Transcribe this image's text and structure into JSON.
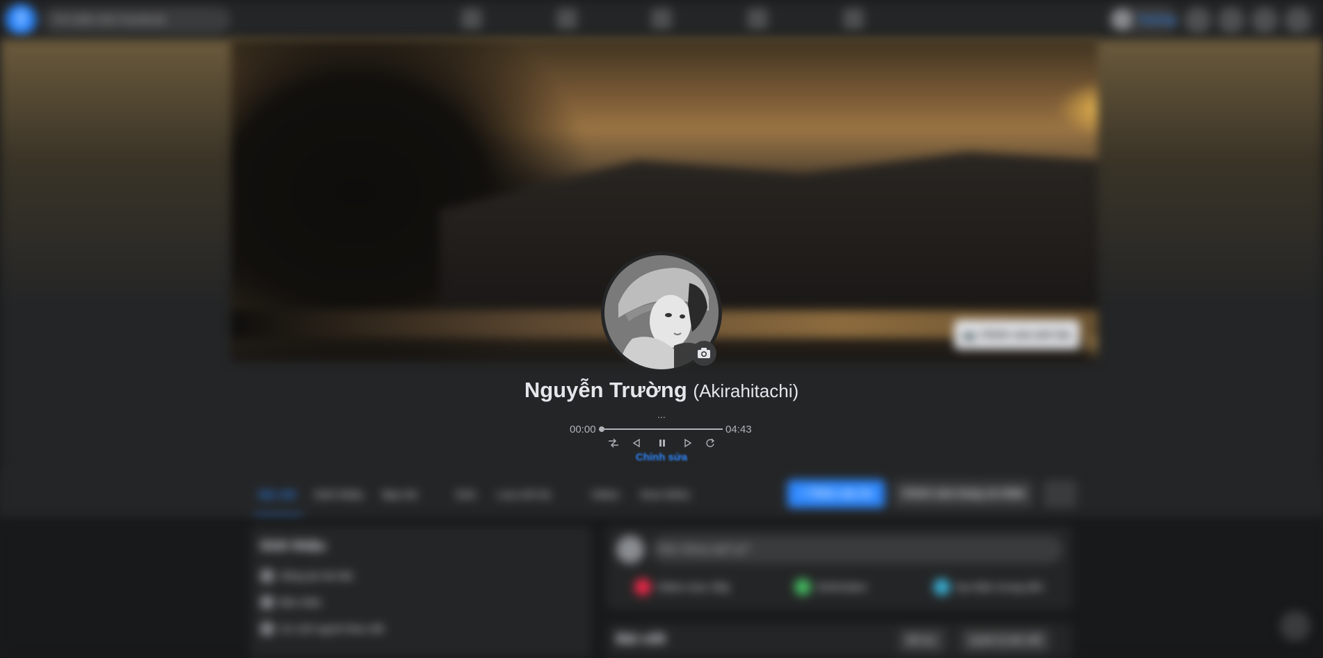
{
  "topbar": {
    "logo_letter": "f",
    "search_placeholder": "Tìm kiếm trên Facebook",
    "user_chip_name": "Trường"
  },
  "cover": {
    "edit_cover_label": "Chỉnh sửa ảnh bìa"
  },
  "profile": {
    "name": "Nguyễn Trường",
    "alternate_name": "(Akirahitachi)",
    "bio_ellipsis": "...",
    "edit_link": "Chỉnh sửa"
  },
  "player": {
    "current_time": "00:00",
    "duration": "04:43",
    "progress": 0,
    "state": "playing",
    "controls": [
      "shuffle-icon",
      "previous-icon",
      "pause-icon",
      "next-icon",
      "repeat-icon"
    ]
  },
  "tabs": {
    "items": [
      "Bài viết",
      "Giới thiệu",
      "Bạn bè",
      "Ảnh",
      "Lưu trữ tin",
      "Video",
      "Xem thêm"
    ],
    "add_story": "+ Thêm vào tin",
    "edit_profile": "Chỉnh sửa trang cá nhân"
  },
  "intro": {
    "title": "Giới thiệu",
    "rows": [
      "Sống tại Hà Nội",
      "Độc thân",
      "Có 120 người theo dõi"
    ]
  },
  "composer": {
    "placeholder": "Bạn đang nghĩ gì?",
    "actions": [
      "Video trực tiếp",
      "Ảnh/video",
      "Sự kiện trong đời"
    ]
  },
  "posts": {
    "title": "Bài viết",
    "filter_label": "Bộ lọc",
    "manage_label": "Quản lý bài viết"
  },
  "colors": {
    "accent": "#2d88ff",
    "background": "#18191a",
    "surface": "#242526"
  }
}
